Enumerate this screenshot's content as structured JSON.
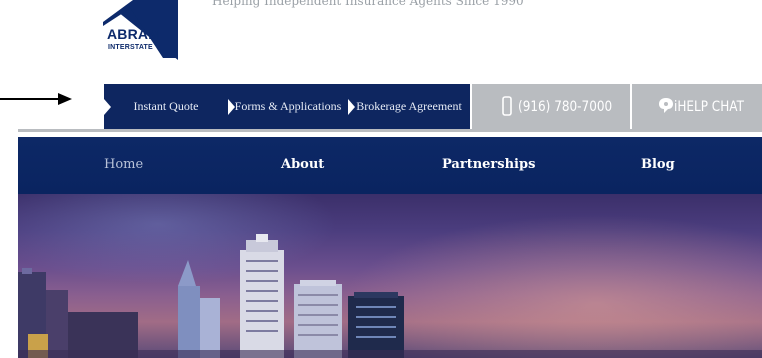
{
  "header": {
    "tagline": "Helping Independent Insurance Agents Since 1990",
    "logo": {
      "line1": "ABRAM",
      "line2": "INTERSTATE",
      "color": "#0d2a6b"
    }
  },
  "topnav": {
    "items": [
      {
        "label": "Instant Quote"
      },
      {
        "label": "Forms & Applications"
      },
      {
        "label": "Brokerage Agreement"
      }
    ],
    "phone": {
      "icon": "phone-icon",
      "label": "(916) 780-7000"
    },
    "chat": {
      "icon": "chat-bubble-icon",
      "label": "iHELP CHAT"
    },
    "colors": {
      "dark": "#0e2660",
      "grey": "#b9bcc0"
    }
  },
  "mainnav": {
    "items": [
      {
        "label": "Home"
      },
      {
        "label": "About"
      },
      {
        "label": "Partnerships"
      },
      {
        "label": "Blog"
      }
    ],
    "color": "#0d2866"
  },
  "hero": {
    "alt": "city skyline at dusk"
  }
}
